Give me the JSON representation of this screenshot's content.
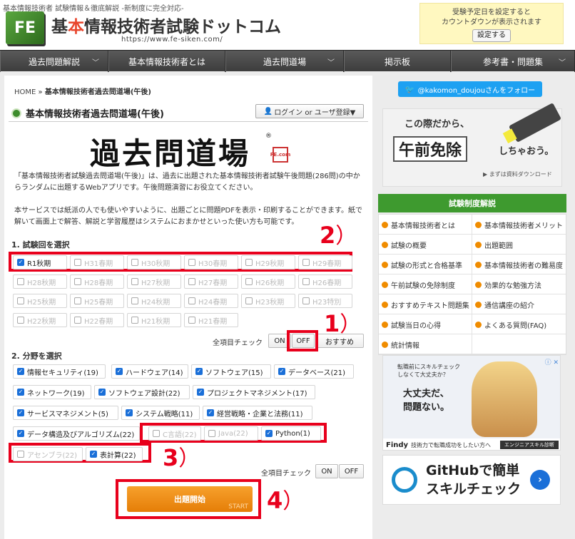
{
  "header": {
    "tagline": "基本情報技術者 試験情報＆徹底解説 -新制度に完全対応-",
    "logo_mark": "FE",
    "title_pre": "基",
    "title_hl": "本",
    "title_post": "情報技術者試験ドットコム",
    "url": "https://www.fe-siken.com/",
    "countdown_line1": "受験予定日を設定すると",
    "countdown_line2": "カウントダウンが表示されます",
    "countdown_button": "設定する"
  },
  "nav": [
    {
      "label": "過去問題解説",
      "chevron": "﹀"
    },
    {
      "label": "基本情報技術者とは",
      "chevron": ""
    },
    {
      "label": "過去問道場",
      "chevron": "﹀"
    },
    {
      "label": "掲示板",
      "chevron": ""
    },
    {
      "label": "参考書・問題集",
      "chevron": "﹀"
    }
  ],
  "breadcrumb": {
    "home": "HOME",
    "sep": "»",
    "current": "基本情報技術者過去問道場(午後)"
  },
  "page": {
    "title": "基本情報技術者過去問道場(午後)",
    "login": "ログイン or ユーザ登録▼",
    "dojo_logo": "過去問道場",
    "dojo_reg": "®",
    "stamp": "FE.com",
    "desc1": "「基本情報技術者試験過去問道場(午後)」は、過去に出題された基本情報技術者試験午後問題(286問)の中からランダムに出題するWebアプリです。午後問題演習にお役立てください。",
    "desc2": "本サービスでは紙派の人でも使いやすいように、出題ごとに問題PDFを表示・印刷することができます。紙で解いて画面上で解答、解説と学習履歴はシステムにおまかせといった使い方も可能です。"
  },
  "step1": {
    "label": "1. 試験回を選択",
    "exams": [
      {
        "label": "R1秋期",
        "checked": true
      },
      {
        "label": "H31春期",
        "checked": false
      },
      {
        "label": "H30秋期",
        "checked": false
      },
      {
        "label": "H30春期",
        "checked": false
      },
      {
        "label": "H29秋期",
        "checked": false
      },
      {
        "label": "H29春期",
        "checked": false
      },
      {
        "label": "H28秋期",
        "checked": false
      },
      {
        "label": "H28春期",
        "checked": false
      },
      {
        "label": "H27秋期",
        "checked": false
      },
      {
        "label": "H27春期",
        "checked": false
      },
      {
        "label": "H26秋期",
        "checked": false
      },
      {
        "label": "H26春期",
        "checked": false
      },
      {
        "label": "H25秋期",
        "checked": false
      },
      {
        "label": "H25春期",
        "checked": false
      },
      {
        "label": "H24秋期",
        "checked": false
      },
      {
        "label": "H24春期",
        "checked": false
      },
      {
        "label": "H23秋期",
        "checked": false
      },
      {
        "label": "H23特別",
        "checked": false
      },
      {
        "label": "H22秋期",
        "checked": false
      },
      {
        "label": "H22春期",
        "checked": false
      },
      {
        "label": "H21秋期",
        "checked": false
      },
      {
        "label": "H21春期",
        "checked": false
      }
    ],
    "all_label": "全項目チェック",
    "on": "ON",
    "off": "OFF",
    "recommend": "おすすめ"
  },
  "step2": {
    "label": "2. 分野を選択",
    "fields": [
      {
        "label": "情報セキュリティ(19)",
        "checked": true
      },
      {
        "label": "ハードウェア(14)",
        "checked": true
      },
      {
        "label": "ソフトウェア(15)",
        "checked": true
      },
      {
        "label": "データベース(21)",
        "checked": true
      },
      {
        "label": "ネットワーク(19)",
        "checked": true
      },
      {
        "label": "ソフトウェア設計(22)",
        "checked": true
      },
      {
        "label": "プロジェクトマネジメント(17)",
        "checked": true
      },
      {
        "label": "サービスマネジメント(5)",
        "checked": true
      },
      {
        "label": "システム戦略(11)",
        "checked": true
      },
      {
        "label": "経営戦略・企業と法務(11)",
        "checked": true
      },
      {
        "label": "データ構造及びアルゴリズム(22)",
        "checked": true
      },
      {
        "label": "C言語(22)",
        "checked": false
      },
      {
        "label": "Java(22)",
        "checked": false
      },
      {
        "label": "Python(1)",
        "checked": true
      },
      {
        "label": "アセンブラ(22)",
        "checked": false
      },
      {
        "label": "表計算(22)",
        "checked": true
      }
    ],
    "all_label": "全項目チェック",
    "on": "ON",
    "off": "OFF"
  },
  "start": {
    "label": "出題開始",
    "sub": "START"
  },
  "annotations": {
    "a1": "1",
    "a2": "2",
    "a3": "3",
    "a4": "4",
    "paren": "）"
  },
  "sidebar": {
    "follow": "@kakomon_doujouさんをフォロー",
    "twitter_glyph": "🐦",
    "ad1_line1": "この際だから、",
    "ad1_big": "午前免除",
    "ad1_tail": "しちゃおう。",
    "ad1_small": "▶ まずは資料ダウンロード",
    "menu_title": "試験制度解説",
    "menu": [
      "基本情報技術者とは",
      "基本情報技術者メリット",
      "試験の概要",
      "出題範囲",
      "試験の形式と合格基準",
      "基本情報技術者の難易度",
      "午前試験の免除制度",
      "効果的な勉強方法",
      "おすすめテキスト問題集",
      "通信講座の紹介",
      "試験当日の心得",
      "よくある質問(FAQ)",
      "統計情報",
      ""
    ],
    "ad2_line1": "転職前にスキルチェック",
    "ad2_line2": "しなくて大丈夫か？",
    "ad2_big1": "大丈夫だ、",
    "ad2_big2": "問題ない。",
    "ad2_brand": "Findy",
    "ad2_small": "技術力で転職成功をしたい方へ",
    "ad2_cta": "エンジニアスキル診断",
    "ad2_close": "ⓘ ✕",
    "ad3_line1": "GitHubで簡単",
    "ad3_line2": "スキルチェック",
    "ad3_arrow": "›"
  },
  "colors": {
    "accent_green": "#3e9a2f",
    "annotation_red": "#e8001c",
    "start_orange": "#f08c00",
    "twitter_blue": "#1da1f2"
  }
}
